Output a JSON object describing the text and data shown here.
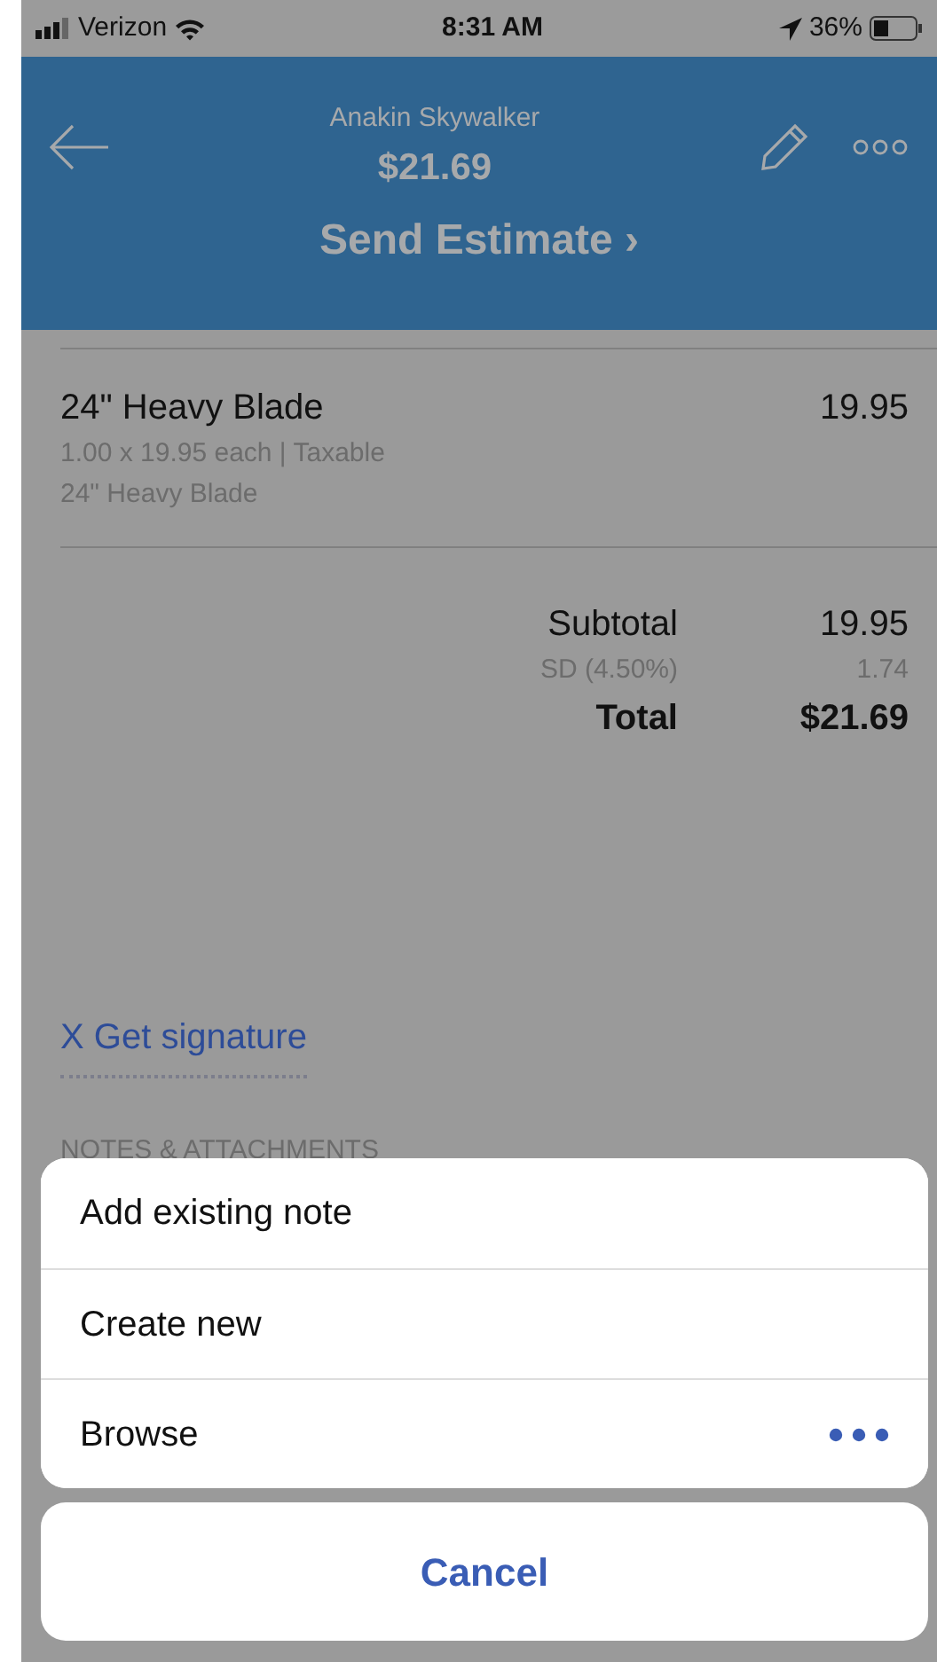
{
  "status_bar": {
    "carrier": "Verizon",
    "time": "8:31 AM",
    "battery": "36%"
  },
  "header": {
    "customer": "Anakin Skywalker",
    "amount": "$21.69",
    "action": "Send Estimate",
    "chevron": "›"
  },
  "line_items": [
    {
      "name": "24\" Heavy Blade",
      "amount": "19.95",
      "detail": "1.00 x 19.95 each | Taxable",
      "description": "24\" Heavy Blade"
    }
  ],
  "totals": [
    {
      "kind": "subtotal",
      "label": "Subtotal",
      "value": "19.95"
    },
    {
      "kind": "tax",
      "label": "SD (4.50%)",
      "value": "1.74"
    },
    {
      "kind": "total",
      "label": "Total",
      "value": "$21.69"
    }
  ],
  "signature_link": "X Get signature",
  "section_heading": "NOTES & ATTACHMENTS",
  "action_sheet": {
    "items": [
      {
        "label": "Add existing note",
        "kind": "plain"
      },
      {
        "label": "Create new",
        "kind": "plain"
      },
      {
        "label": "Browse",
        "kind": "more"
      }
    ],
    "cancel": "Cancel"
  }
}
